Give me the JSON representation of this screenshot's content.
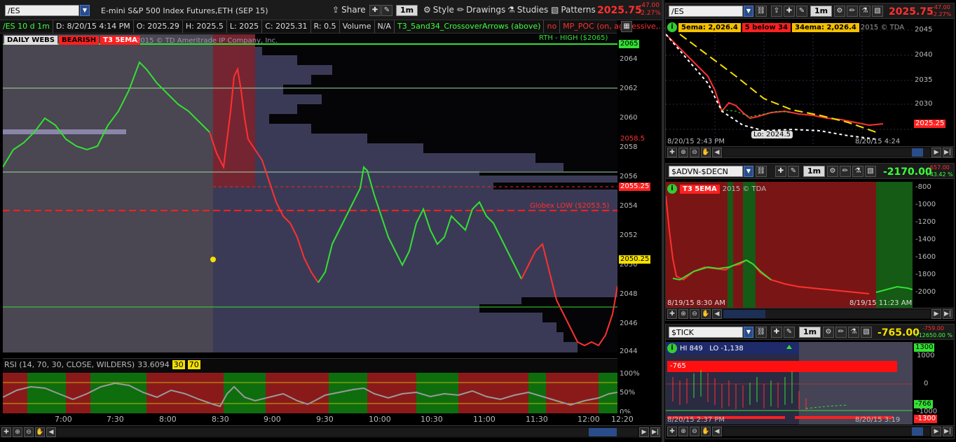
{
  "main": {
    "symbol": "/ES",
    "description": "E-mini S&P 500 Index Futures,ETH (SEP 15)",
    "toolbar": {
      "share": "Share",
      "timeframe": "1m",
      "style": "Style",
      "drawings": "Drawings",
      "studies": "Studies",
      "patterns": "Patterns"
    },
    "last_price": "2025.75",
    "change": "-47.00",
    "change_pct": "-2.27%",
    "info": {
      "aggregation": "/ES 10 d 1m",
      "date": "D: 8/20/15 4:14 PM",
      "open": "O: 2025.29",
      "high": "H: 2025.5",
      "low": "L: 2025",
      "close": "C: 2025.31",
      "range": "R: 0.5",
      "volume": "Volume",
      "volume_value": "N/A",
      "study1": "T3_5and34_CrossoverArrows (above)",
      "study1_flag": "no",
      "study2": "MP_POC (on, aggressive,..."
    },
    "badges": {
      "daily": "DAILY WEBS",
      "bearish": "BEARISH",
      "t3": "T3 5EMA"
    },
    "copyright": "2015 © TD Ameritrade IP Company, Inc.",
    "rth_high": "RTH - HIGH ($2065)",
    "globex_low": "Globex LOW ($2053.5)",
    "y_axis": [
      "2064",
      "2062",
      "2060",
      "2058",
      "2056",
      "2054",
      "2052",
      "2050",
      "2048",
      "2046",
      "2044"
    ],
    "price_tags": {
      "p2065": "2065",
      "p2058_5": "2058.5",
      "p2055_25": "2055.25",
      "p2050_25": "2050.25"
    },
    "rsi_label": "RSI (14, 70, 30, CLOSE, WILDERS)",
    "rsi_value": "33.6094",
    "rsi_30": "30",
    "rsi_70": "70",
    "rsi_axis": [
      "100%",
      "50%",
      "0%"
    ],
    "time_axis": [
      "7:00",
      "7:30",
      "8:00",
      "8:30",
      "9:00",
      "9:30",
      "10:00",
      "10:30",
      "11:00",
      "11:30",
      "12:00",
      "12:20"
    ]
  },
  "es_panel": {
    "symbol": "/ES",
    "timeframe": "1m",
    "last_price": "2025.75",
    "change": "-47.00",
    "change_pct": "-2.27%",
    "label_5ema": "5ema: 2,026.4",
    "label_below": "5 below 34",
    "label_34ema": "34ema: 2,026.4",
    "copyright": "2015 © TDA",
    "y_axis": [
      "2045",
      "2040",
      "2035",
      "2030",
      "2025"
    ],
    "price_tag": "2025.25",
    "lo_label": "Lo: 2024.5",
    "start_time": "8/20/15 2:43 PM",
    "end_time": "8/20/15 4:24 PM"
  },
  "advn_panel": {
    "symbol": "$ADVN-$DECN",
    "timeframe": "1m",
    "last_price": "-2170.00",
    "change": "-657.00",
    "change_pct": "+43.42 %",
    "badge": "T3 5EMA",
    "copyright": "2015 © TDA",
    "y_axis": [
      "-800",
      "-1000",
      "-1200",
      "-1400",
      "-1600",
      "-1800",
      "-2000"
    ],
    "start_time": "8/19/15 8:30 AM",
    "end_time": "8/19/15 11:23 AM"
  },
  "tick_panel": {
    "symbol": "$TICK",
    "timeframe": "1m",
    "last_price": "-765.00",
    "change": "-759.00",
    "change_pct": "+12650.00 %",
    "hi_lo": "HI 849   LO -1,138",
    "bar_value": "-765",
    "y_axis": [
      "1000",
      "0",
      "-1000"
    ],
    "tag_top": "1300",
    "tag_mid": "-766",
    "tag_bottom": "-1300",
    "start_time": "8/20/15 2:37 PM",
    "end_time": "8/20/15 3:19 PM"
  },
  "colors": {
    "bull": "#33e033",
    "bear": "#ff2020",
    "panel_bg": "#3b3a56",
    "accent": "#2a4d8a"
  }
}
